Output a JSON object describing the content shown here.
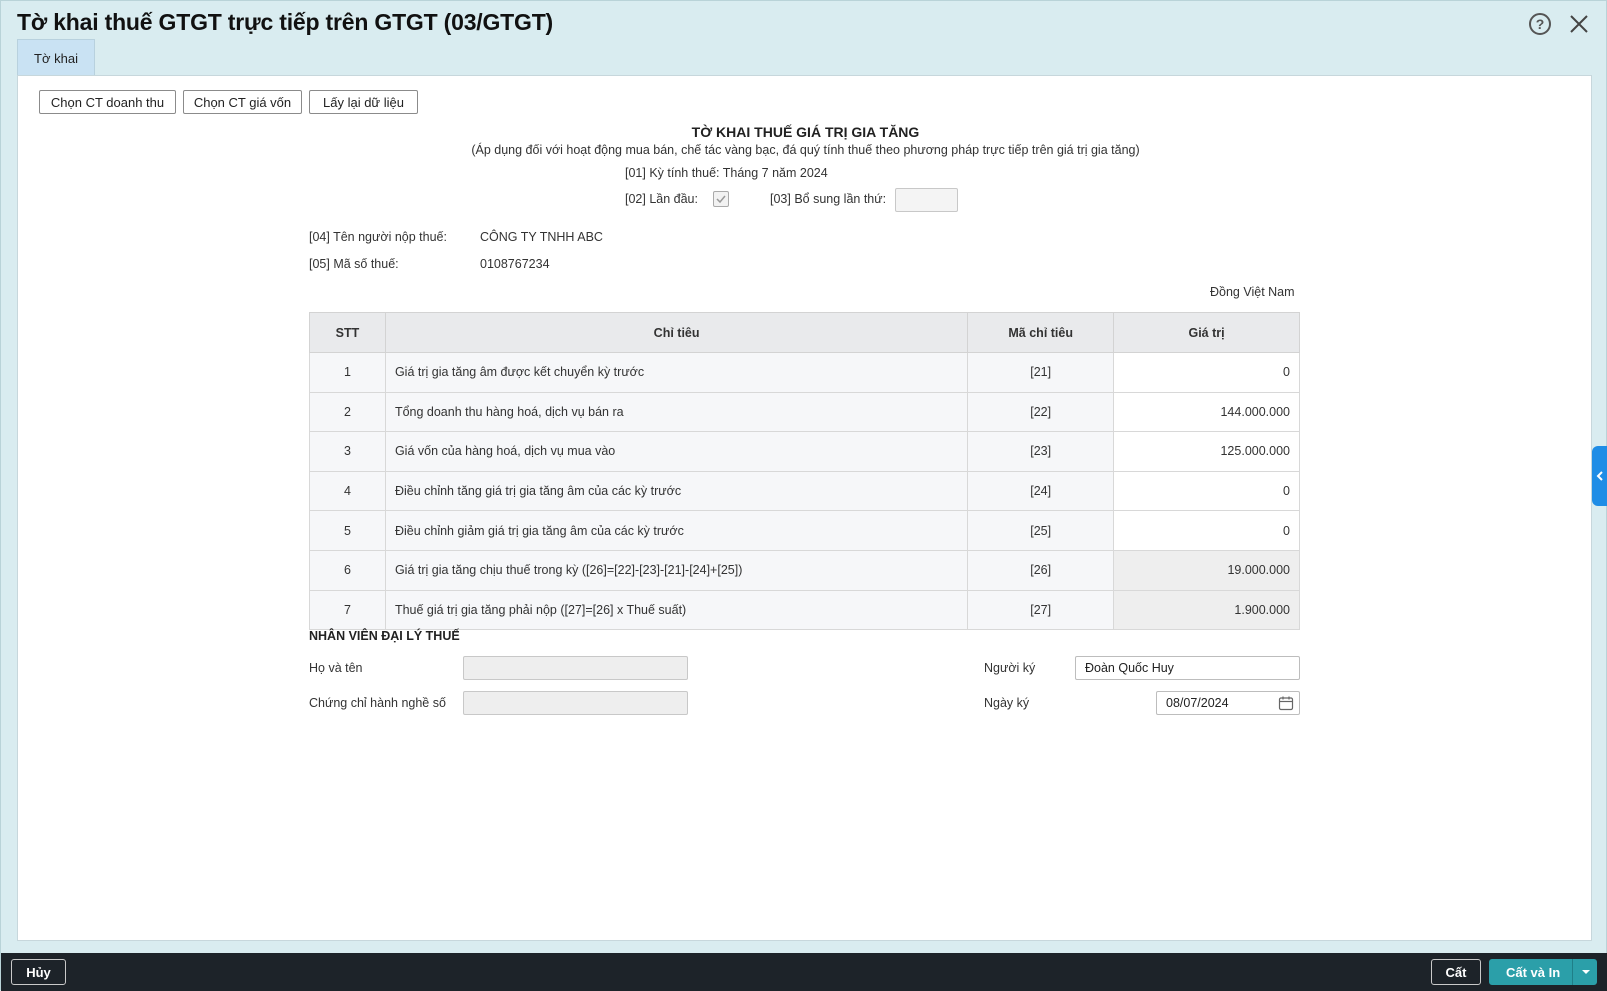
{
  "dialog": {
    "title": "Tờ khai thuế GTGT trực tiếp trên GTGT (03/GTGT)",
    "help_label": "?"
  },
  "tabs": [
    {
      "label": "Tờ khai"
    }
  ],
  "toolbar": {
    "btn_revenue": "Chọn CT doanh thu",
    "btn_cost": "Chọn CT giá vốn",
    "btn_reload": "Lấy lại dữ liệu"
  },
  "form": {
    "title": "TỜ KHAI THUẾ GIÁ TRỊ GIA TĂNG",
    "subtitle": "(Áp dụng đối với hoạt động mua bán, chế tác vàng bạc, đá quý tính thuế theo phương pháp trực tiếp trên giá trị gia tăng)",
    "period": "[01] Kỳ tính thuế: Tháng 7 năm 2024",
    "first_time_label": "[02] Lần đầu:",
    "first_time_checked": true,
    "supplement_label": "[03] Bổ sung lần thứ:",
    "supplement_value": "",
    "taxpayer_label": "[04] Tên người nộp thuế:",
    "taxpayer_value": "CÔNG TY TNHH ABC",
    "taxcode_label": "[05] Mã số thuế:",
    "taxcode_value": "0108767234",
    "currency_note": "Đồng Việt Nam"
  },
  "table": {
    "headers": [
      "STT",
      "Chỉ tiêu",
      "Mã chỉ tiêu",
      "Giá trị"
    ],
    "rows": [
      {
        "stt": "1",
        "label": "Giá trị gia tăng âm được kết chuyển kỳ trước",
        "code": "[21]",
        "value": "0"
      },
      {
        "stt": "2",
        "label": "Tổng doanh thu hàng hoá, dịch vụ bán ra",
        "code": "[22]",
        "value": "144.000.000"
      },
      {
        "stt": "3",
        "label": "Giá vốn của hàng hoá, dịch vụ mua vào",
        "code": "[23]",
        "value": "125.000.000"
      },
      {
        "stt": "4",
        "label": "Điều chỉnh tăng giá trị gia tăng âm của các kỳ trước",
        "code": "[24]",
        "value": "0"
      },
      {
        "stt": "5",
        "label": "Điều chỉnh giảm giá trị gia tăng âm của các kỳ trước",
        "code": "[25]",
        "value": "0"
      },
      {
        "stt": "6",
        "label": "Giá trị gia tăng chịu thuế trong kỳ ([26]=[22]-[23]-[21]-[24]+[25])",
        "code": "[26]",
        "value": "19.000.000"
      },
      {
        "stt": "7",
        "label": "Thuế giá trị gia tăng phải nộp ([27]=[26] x Thuế suất)",
        "code": "[27]",
        "value": "1.900.000"
      }
    ]
  },
  "agent": {
    "section_title": "NHÂN VIÊN ĐẠI LÝ THUẾ",
    "name_label": "Họ và tên",
    "name_value": "",
    "cert_label": "Chứng chỉ hành nghề số",
    "cert_value": "",
    "signer_label": "Người ký",
    "signer_value": "Đoàn Quốc Huy",
    "sign_date_label": "Ngày ký",
    "sign_date_value": "08/07/2024"
  },
  "footer": {
    "cancel": "Hủy",
    "save": "Cất",
    "save_print": "Cất và In"
  },
  "colors": {
    "primary": "#2b9fa9",
    "footer_bg": "#1d2329",
    "side_handle": "#1f8de6",
    "tab_active": "#c9e2f3"
  },
  "icons": [
    "help-icon",
    "close-icon",
    "checkmark-icon",
    "calendar-icon",
    "chevron-left-icon",
    "caret-down-icon"
  ]
}
